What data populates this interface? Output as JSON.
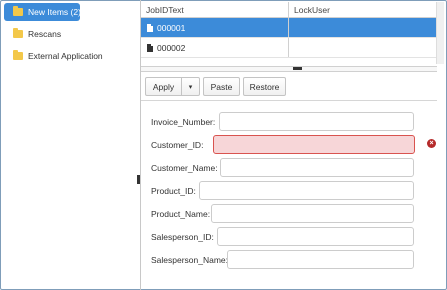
{
  "tree": {
    "items": [
      {
        "label": "New Items (2)",
        "icon": "folder-icon",
        "selected": true
      },
      {
        "label": "Rescans",
        "icon": "folder-icon",
        "selected": false
      },
      {
        "label": "External Application",
        "icon": "folder-icon",
        "selected": false
      }
    ]
  },
  "grid": {
    "columns": [
      "JobIDText",
      "LockUser"
    ],
    "rows": [
      {
        "job_id": "000001",
        "lock_user": "",
        "selected": true
      },
      {
        "job_id": "000002",
        "lock_user": "",
        "selected": false
      }
    ]
  },
  "toolbar": {
    "apply_label": "Apply",
    "apply_dropdown_label": "▾",
    "paste_label": "Paste",
    "restore_label": "Restore"
  },
  "form": {
    "fields": [
      {
        "label": "Invoice_Number:",
        "value": "",
        "error": false
      },
      {
        "label": "Customer_ID:",
        "value": "",
        "error": true
      },
      {
        "label": "Customer_Name:",
        "value": "",
        "error": false
      },
      {
        "label": "Product_ID:",
        "value": "",
        "error": false
      },
      {
        "label": "Product_Name:",
        "value": "",
        "error": false
      },
      {
        "label": "Salesperson_ID:",
        "value": "",
        "error": false
      },
      {
        "label": "Salesperson_Name:",
        "value": "",
        "error": false
      }
    ],
    "error_icon": "error-circle-icon"
  },
  "colors": {
    "selection": "#3c8bd9",
    "folder": "#f3c84a",
    "error_fill": "#f7d6d8",
    "error_border": "#d9534f",
    "error_icon": "#b52a2a"
  }
}
